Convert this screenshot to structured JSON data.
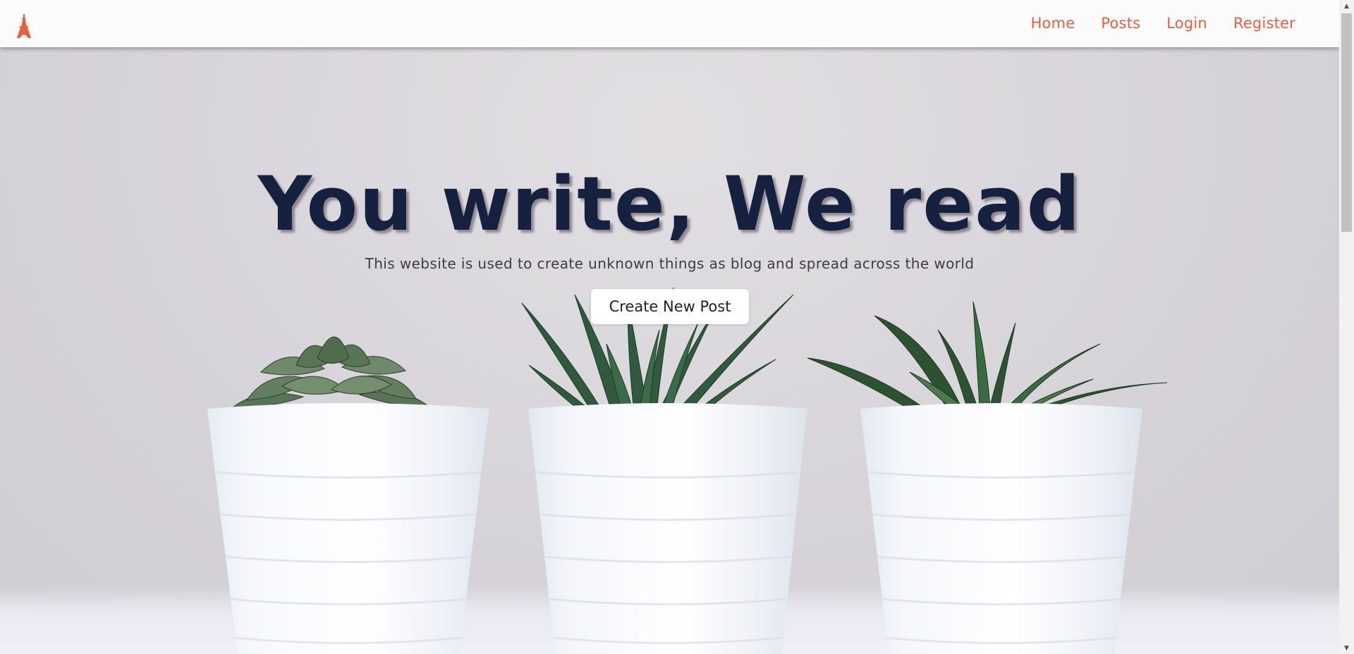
{
  "navbar": {
    "brand_icon": "eiffel-tower-icon",
    "links": [
      {
        "label": "Home"
      },
      {
        "label": "Posts"
      },
      {
        "label": "Login"
      },
      {
        "label": "Register"
      }
    ],
    "link_color": "#ee5d3c"
  },
  "hero": {
    "title": "You write, We read",
    "subtitle": "This website is used to create unknown things as blog and spread across the world",
    "cta_label": "Create New Post",
    "title_color": "#15213f"
  },
  "scrollbar": {
    "up_icon": "scroll-up-arrow-icon",
    "down_icon": "scroll-down-arrow-icon"
  }
}
